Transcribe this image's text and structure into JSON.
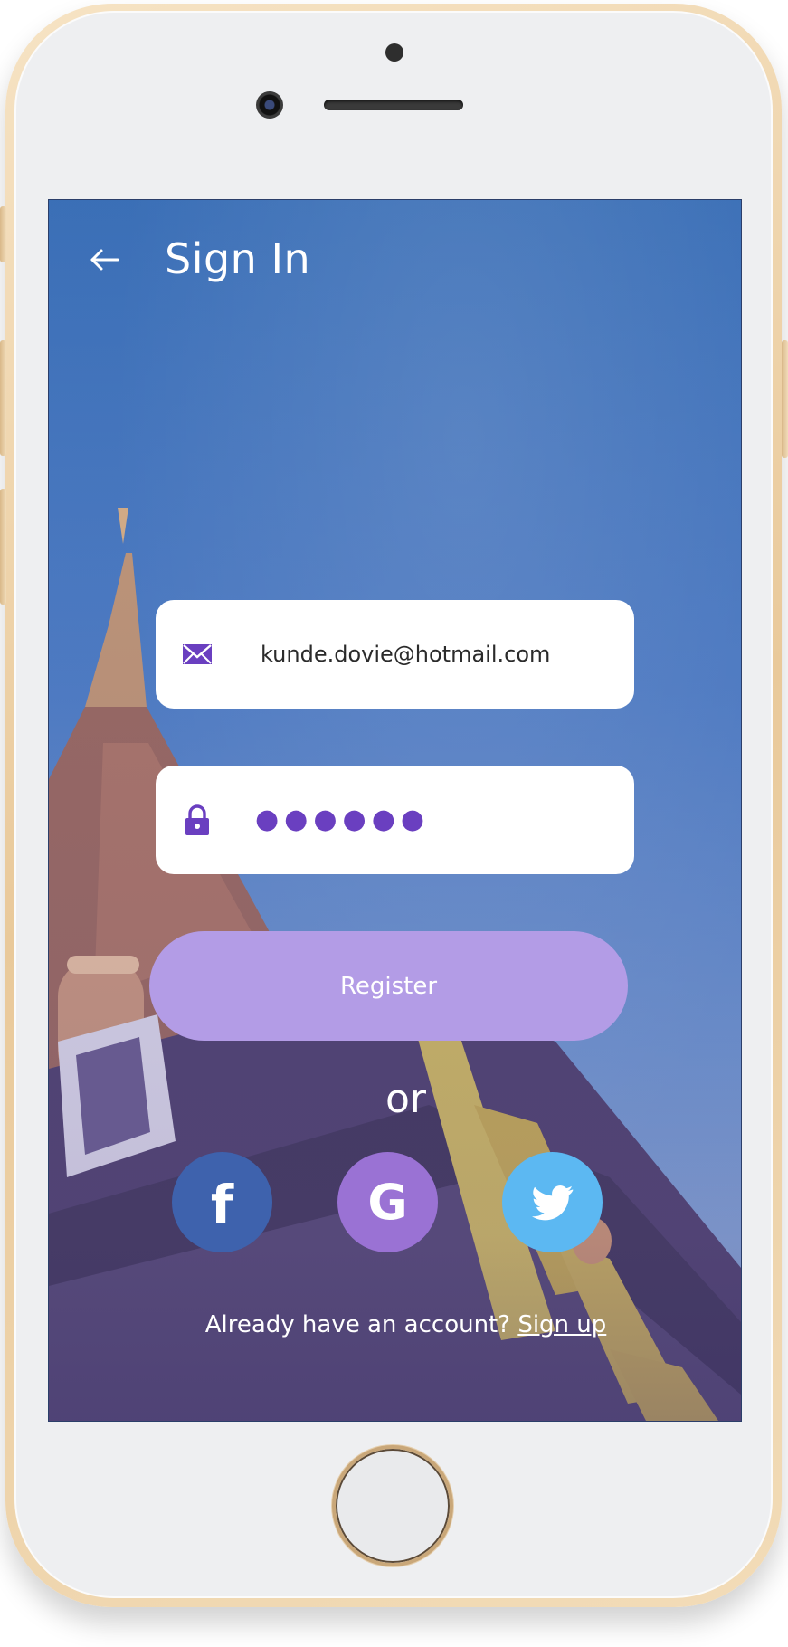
{
  "header": {
    "title": "Sign In"
  },
  "form": {
    "email_value": "kunde.dovie@hotmail.com",
    "password_masked": "●●●●●●",
    "register_label": "Register"
  },
  "divider": {
    "text": "or"
  },
  "social": {
    "facebook_glyph": "f",
    "google_glyph": "G"
  },
  "footer": {
    "prompt": "Already have an account?",
    "link_label": "Sign up"
  },
  "colors": {
    "accent_purple": "#6a3fc0",
    "register_button": "#b39ce6",
    "facebook": "#3e62ad",
    "google": "#9a72d4",
    "twitter": "#5cb8f2"
  },
  "icons": [
    "back-arrow-icon",
    "mail-icon",
    "lock-icon",
    "facebook-icon",
    "google-icon",
    "twitter-icon"
  ]
}
